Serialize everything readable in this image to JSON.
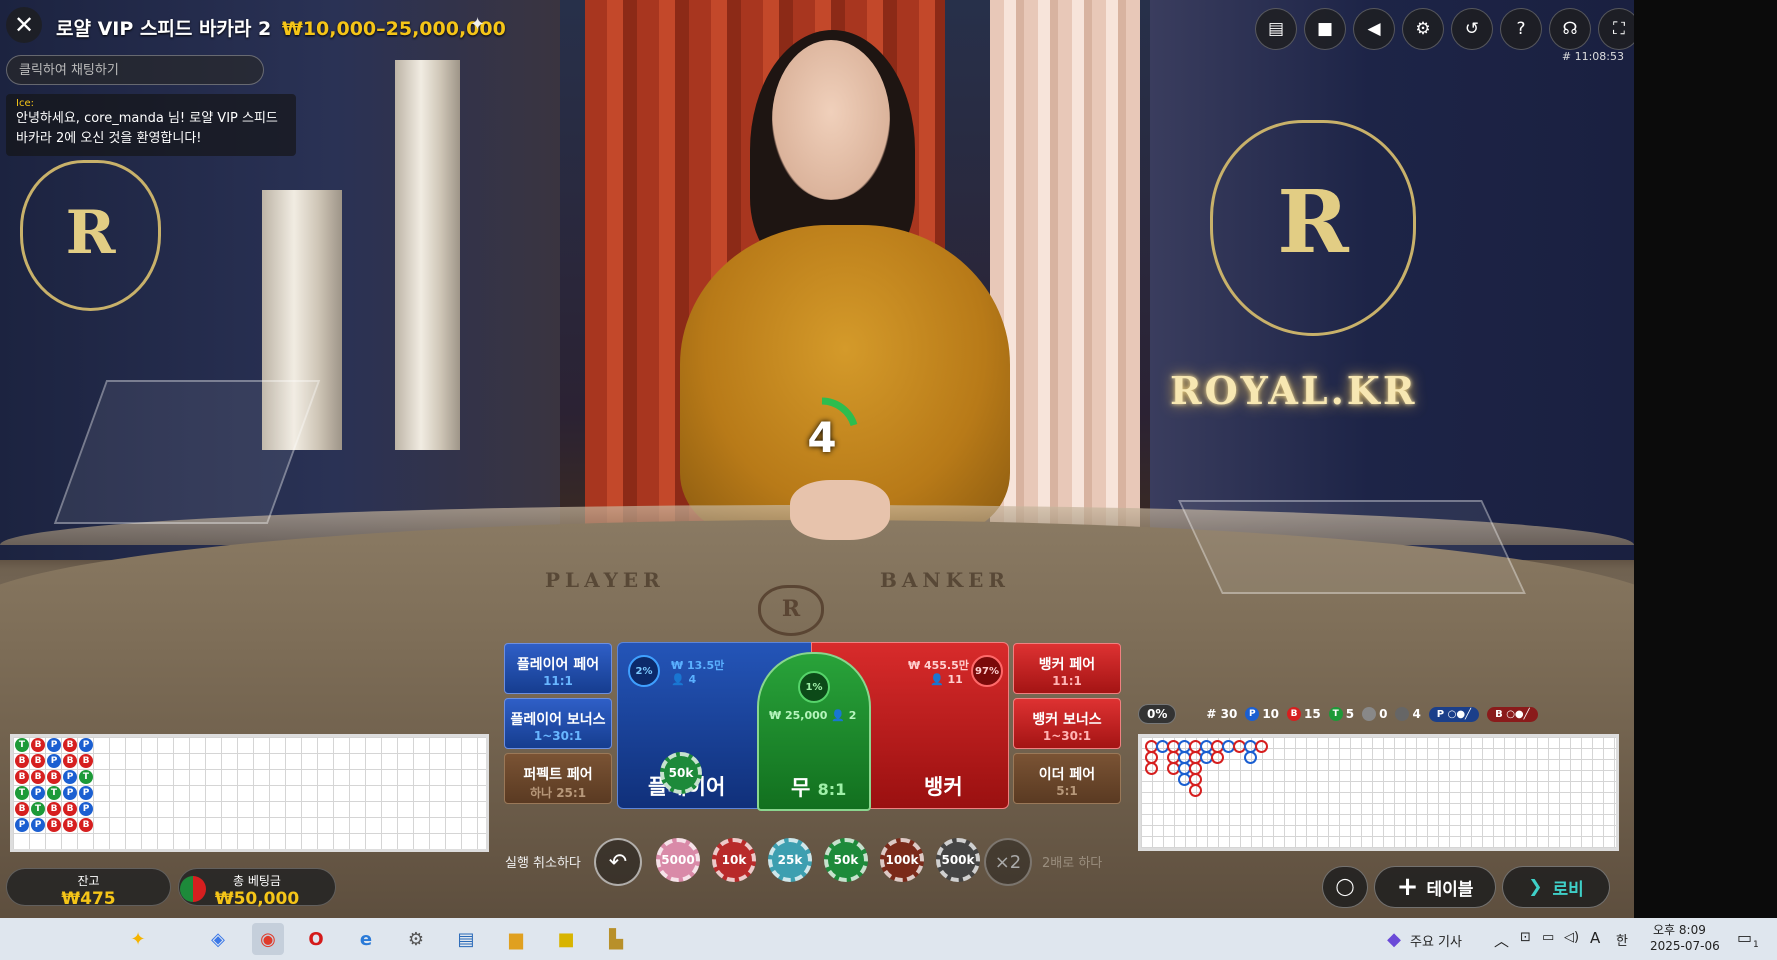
{
  "header": {
    "title": "로얄 VIP 스피드 바카라 2",
    "limits": "₩10,000–25,000,000",
    "game_id": "# 11:08:53"
  },
  "chat": {
    "placeholder": "클릭하여 채팅하기",
    "sender": "Ice:",
    "message": "안녕하세요, core_manda 님! 로얄 VIP 스피드 바카라 2에 오신 것을 환영합니다!"
  },
  "scene": {
    "brand": "ROYAL.KR",
    "felt_player": "PLAYER",
    "felt_banker": "BANKER",
    "timer": "4"
  },
  "bets": {
    "player_pair": {
      "label": "플레이어 페어",
      "odds": "11:1"
    },
    "player_bonus": {
      "label": "플레이어 보너스",
      "odds": "1~30:1"
    },
    "perfect_pair": {
      "label": "퍼펙트 페어",
      "odds": "하나 25:1"
    },
    "banker_pair": {
      "label": "뱅커 페어",
      "odds": "11:1"
    },
    "banker_bonus": {
      "label": "뱅커 보너스",
      "odds": "1~30:1"
    },
    "either_pair": {
      "label": "이더 페어",
      "odds": "5:1"
    },
    "player": {
      "label": "플레이어",
      "pct": "2%",
      "amount": "₩ 13.5만",
      "players": "4"
    },
    "tie": {
      "label": "무",
      "odds": "8:1",
      "pct": "1%",
      "amount": "₩ 25,000",
      "players": "2"
    },
    "banker": {
      "label": "뱅커",
      "pct": "97%",
      "amount": "₩ 455.5만",
      "players": "11"
    },
    "placed_chip": "50k"
  },
  "chips": {
    "undo_label": "실행 취소하다",
    "double_label": "2배로 하다",
    "double_symbol": "×2",
    "values": [
      "5000",
      "10k",
      "25k",
      "50k",
      "100k",
      "500k"
    ],
    "colors": [
      "#d98aa8",
      "#b82a2a",
      "#3d9fb0",
      "#1d8a3a",
      "#7a2a1a",
      "#444444"
    ]
  },
  "wallet": {
    "balance_label": "잔고",
    "balance": "₩475",
    "total_bet_label": "총 베팅금",
    "total_bet": "₩50,000"
  },
  "bead_road": [
    [
      "T",
      "B",
      "P",
      "B",
      "P"
    ],
    [
      "B",
      "B",
      "P",
      "B",
      "B"
    ],
    [
      "B",
      "B",
      "B",
      "P",
      "T"
    ],
    [
      "T",
      "P",
      "T",
      "P",
      "P"
    ],
    [
      "B",
      "T",
      "B",
      "B",
      "P"
    ],
    [
      "P",
      "P",
      "B",
      "B",
      "B"
    ]
  ],
  "stats": {
    "percent": "0%",
    "rounds": "# 30",
    "player_wins": "10",
    "banker_wins": "15",
    "ties": "5",
    "player_pairs": "0",
    "banker_pairs": "4"
  },
  "buttons": {
    "table": "테이블",
    "lobby": "로비"
  },
  "taskbar": {
    "news": "주요 기사",
    "time": "오후 8:09",
    "date": "2025-07-06",
    "ime": "A",
    "ime2": "한",
    "notif": "1"
  }
}
